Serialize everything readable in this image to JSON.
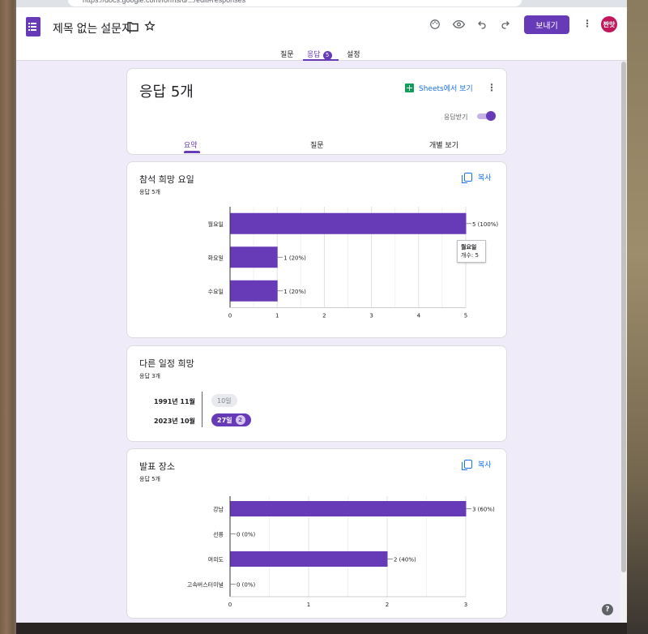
{
  "browser": {
    "url_fragment": "https://docs.google.com/forms/d/.../edit#responses"
  },
  "app": {
    "doc_title": "제목 없는 설문지",
    "send_label": "보내기",
    "avatar_text": "짠맛"
  },
  "tabs": [
    {
      "label": "질문",
      "active": false
    },
    {
      "label": "응답",
      "active": true,
      "badge": "5"
    },
    {
      "label": "설정",
      "active": false
    }
  ],
  "summary_card": {
    "title": "응답 5개",
    "sheets_label": "Sheets에서 보기",
    "accepting_label": "응답받기",
    "accepting": true,
    "subtabs": [
      {
        "label": "요약",
        "active": true
      },
      {
        "label": "질문",
        "active": false
      },
      {
        "label": "개별 보기",
        "active": false
      }
    ]
  },
  "questions": [
    {
      "title": "참석 희망 요일",
      "count_label": "응답 5개",
      "copy_label": "복사",
      "tooltip": {
        "title": "월요일",
        "label": "개수: 5"
      }
    },
    {
      "title": "다른 일정 희망",
      "count_label": "응답 3개",
      "dates": [
        {
          "month": "1991년 11월",
          "chip": "10일",
          "highlight": false,
          "count": ""
        },
        {
          "month": "2023년 10월",
          "chip": "27일",
          "highlight": true,
          "count": "2"
        }
      ]
    },
    {
      "title": "발표 장소",
      "count_label": "응답 5개",
      "copy_label": "복사"
    }
  ],
  "chart_data": [
    {
      "type": "bar",
      "orientation": "horizontal",
      "categories": [
        "월요일",
        "화요일",
        "수요일"
      ],
      "values": [
        5,
        1,
        1
      ],
      "data_labels": [
        "5 (100%)",
        "1 (20%)",
        "1 (20%)"
      ],
      "xlim": [
        0,
        5
      ],
      "xticks": [
        "0",
        "1",
        "2",
        "3",
        "4",
        "5"
      ],
      "color": "#673ab7",
      "grid": true
    },
    {
      "type": "bar",
      "orientation": "horizontal",
      "categories": [
        "강남",
        "선릉",
        "여의도",
        "고속버스터미널"
      ],
      "values": [
        3,
        0,
        2,
        0
      ],
      "data_labels": [
        "3 (60%)",
        "0 (0%)",
        "2 (40%)",
        "0 (0%)"
      ],
      "xlim": [
        0,
        3
      ],
      "xticks": [
        "0",
        "1",
        "2",
        "3"
      ],
      "color": "#673ab7",
      "grid": true
    }
  ],
  "colors": {
    "accent": "#673ab7",
    "link": "#1a73e8",
    "page_bg": "#f0ebf8"
  },
  "help_icon": "?"
}
